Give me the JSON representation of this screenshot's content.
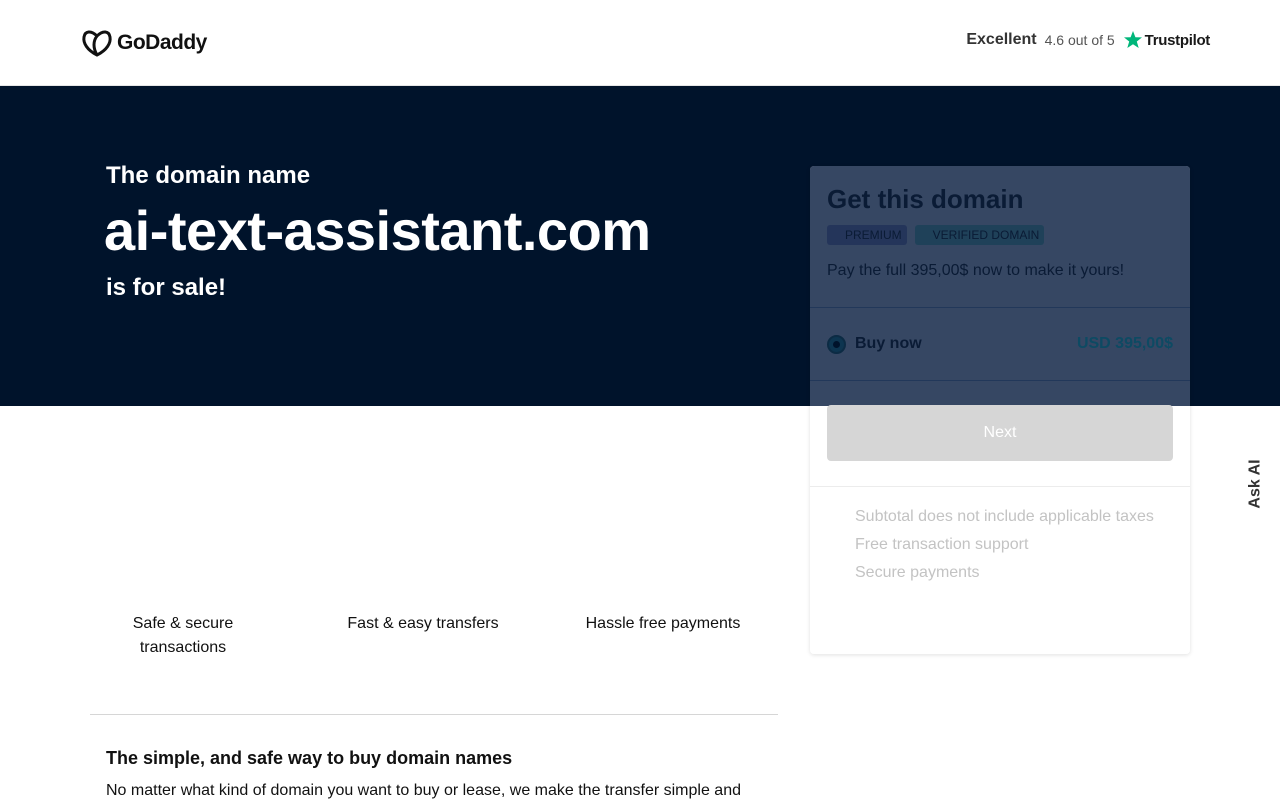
{
  "header": {
    "logo_text": "GoDaddy",
    "trust": {
      "label": "Excellent",
      "rating": "4.6 out of 5",
      "brand": "Trustpilot",
      "star_color": "#00b67a"
    }
  },
  "hero": {
    "kicker": "The domain name",
    "domain": "ai-text-assistant.com",
    "sale": "is for sale!",
    "background": "#00132b"
  },
  "purchase_card": {
    "title": "Get this domain",
    "badges": [
      "PREMIUM",
      "VERIFIED DOMAIN"
    ],
    "description": "Pay the full 395,00$ now to make it yours!",
    "option": {
      "label": "Buy now",
      "price": "USD 395,00$"
    },
    "next_button": "Next",
    "perks": [
      "Subtotal does not include applicable taxes",
      "Free transaction support",
      "Secure payments"
    ]
  },
  "features": [
    "Safe & secure transactions",
    "Fast & easy transfers",
    "Hassle free payments"
  ],
  "info": {
    "title": "The simple, and safe way to buy domain names",
    "text": "No matter what kind of domain you want to buy or lease, we make the transfer simple and"
  },
  "ask_ai": {
    "label": "Ask AI"
  }
}
